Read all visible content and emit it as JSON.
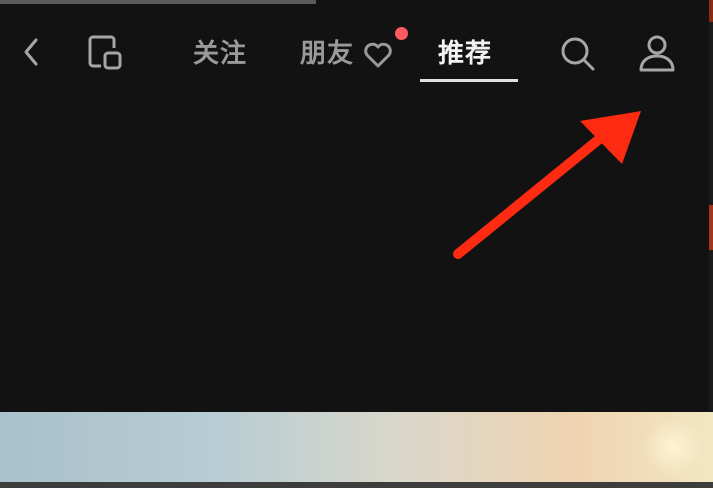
{
  "header": {
    "tabs": [
      {
        "label": "关注",
        "active": false
      },
      {
        "label": "朋友",
        "active": false,
        "has_notification": true
      },
      {
        "label": "推荐",
        "active": true
      }
    ]
  },
  "icons": {
    "back": "chevron-left",
    "screen": "screen-cast",
    "friends_heart": "heart",
    "search": "magnifier",
    "profile": "person-outline"
  },
  "colors": {
    "background": "#121212",
    "tab_inactive": "#9a9a9a",
    "tab_active": "#f2f2f2",
    "notification_dot": "#ff5a5f",
    "annotation_arrow": "#ff2a12"
  }
}
